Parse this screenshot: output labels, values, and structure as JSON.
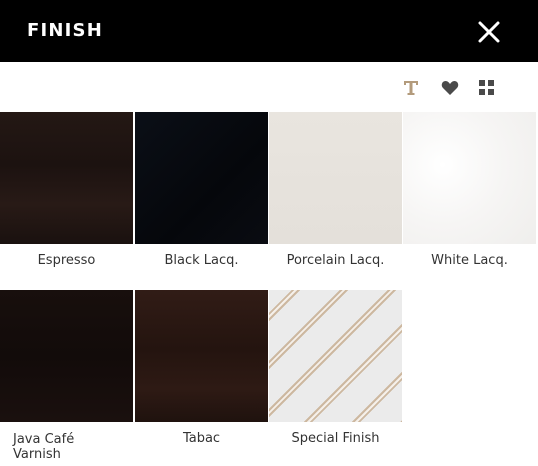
{
  "header": {
    "title": "FINISH"
  },
  "icons": {
    "close": "close-icon",
    "text": "text-icon",
    "favorite": "heart-icon",
    "grid": "grid-icon"
  },
  "colors": {
    "header_bg": "#000000",
    "accent_icon": "#b39b7c",
    "icon_gray": "#4a4a4a"
  },
  "swatches": [
    {
      "label": "Espresso",
      "color": "#1f1512"
    },
    {
      "label": "Black Lacq.",
      "color": "#06080d"
    },
    {
      "label": "Porcelain Lacq.",
      "color": "#e6e2dc"
    },
    {
      "label": "White Lacq.",
      "color": "#f4f3f2"
    },
    {
      "label": "Java Café\nVarnish",
      "color": "#150d0c"
    },
    {
      "label": "Tabac",
      "color": "#2a1813"
    },
    {
      "label": "Special Finish",
      "color": "#ececec"
    }
  ]
}
